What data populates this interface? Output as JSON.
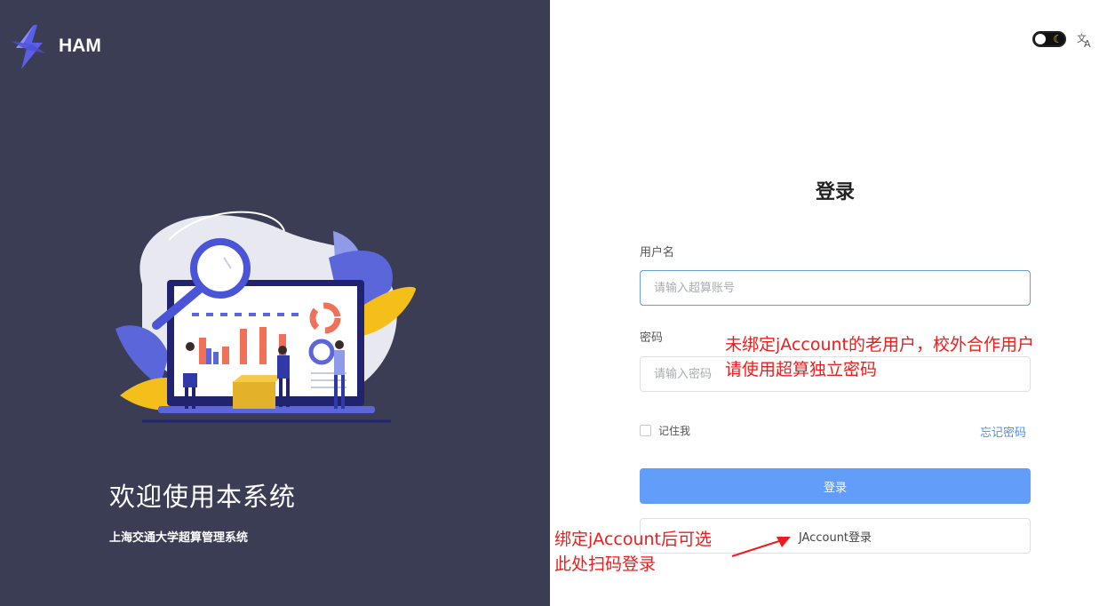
{
  "brand": {
    "name": "HAM"
  },
  "left": {
    "welcome": "欢迎使用本系统",
    "subtitle": "上海交通大学超算管理系统"
  },
  "header": {
    "theme_icon": "moon-icon",
    "lang_icon": "translate-icon"
  },
  "form": {
    "title": "登录",
    "username_label": "用户名",
    "username_placeholder": "请输入超算账号",
    "password_label": "密码",
    "password_placeholder": "请输入密码",
    "remember_label": "记住我",
    "forgot_link": "忘记密码",
    "login_button": "登录",
    "jaccount_button": "JAccount登录"
  },
  "annotations": {
    "password_note_line1": "未绑定jAccount的老用户，校外合作用户",
    "password_note_line2": "请使用超算独立密码",
    "jaccount_note_line1": "绑定jAccount后可选",
    "jaccount_note_line2": "此处扫码登录"
  },
  "colors": {
    "left_bg": "#3a3d54",
    "primary": "#629ef9",
    "annotation": "#ee1c1c"
  }
}
